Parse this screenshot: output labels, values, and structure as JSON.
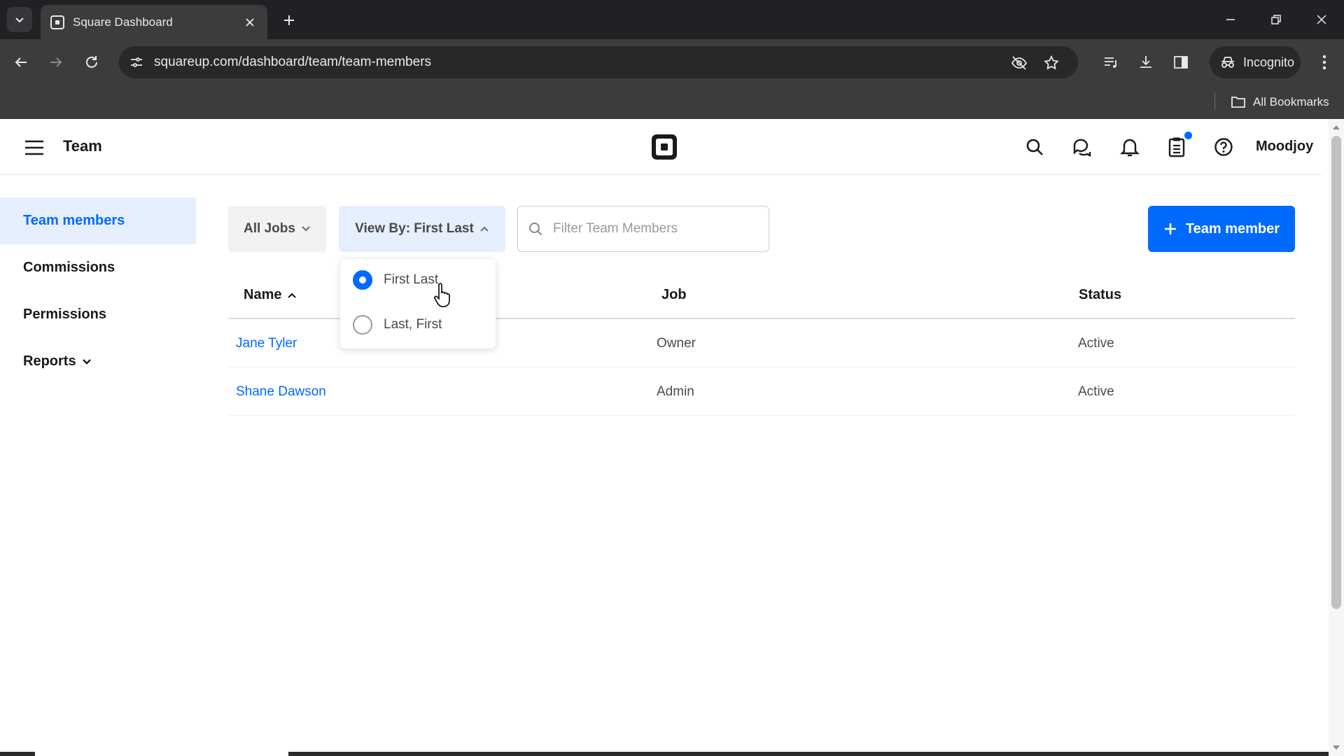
{
  "browser": {
    "tab_title": "Square Dashboard",
    "url": "squareup.com/dashboard/team/team-members",
    "incognito_label": "Incognito",
    "bookmarks_label": "All Bookmarks"
  },
  "header": {
    "title": "Team",
    "account_name": "Moodjoy"
  },
  "sidebar": {
    "items": [
      {
        "label": "Team members"
      },
      {
        "label": "Commissions"
      },
      {
        "label": "Permissions"
      },
      {
        "label": "Reports"
      }
    ]
  },
  "controls": {
    "jobs_filter": "All Jobs",
    "view_by": "View By: First Last",
    "search_placeholder": "Filter Team Members",
    "add_button": "Team member"
  },
  "view_menu": {
    "options": [
      {
        "label": "First Last",
        "selected": true
      },
      {
        "label": "Last, First",
        "selected": false
      }
    ]
  },
  "table": {
    "columns": [
      "Name",
      "Job",
      "Status"
    ],
    "rows": [
      {
        "name": "Jane Tyler",
        "job": "Owner",
        "status": "Active"
      },
      {
        "name": "Shane Dawson",
        "job": "Admin",
        "status": "Active"
      }
    ]
  },
  "colors": {
    "accent": "#006aff",
    "active_bg": "#e6effe"
  }
}
